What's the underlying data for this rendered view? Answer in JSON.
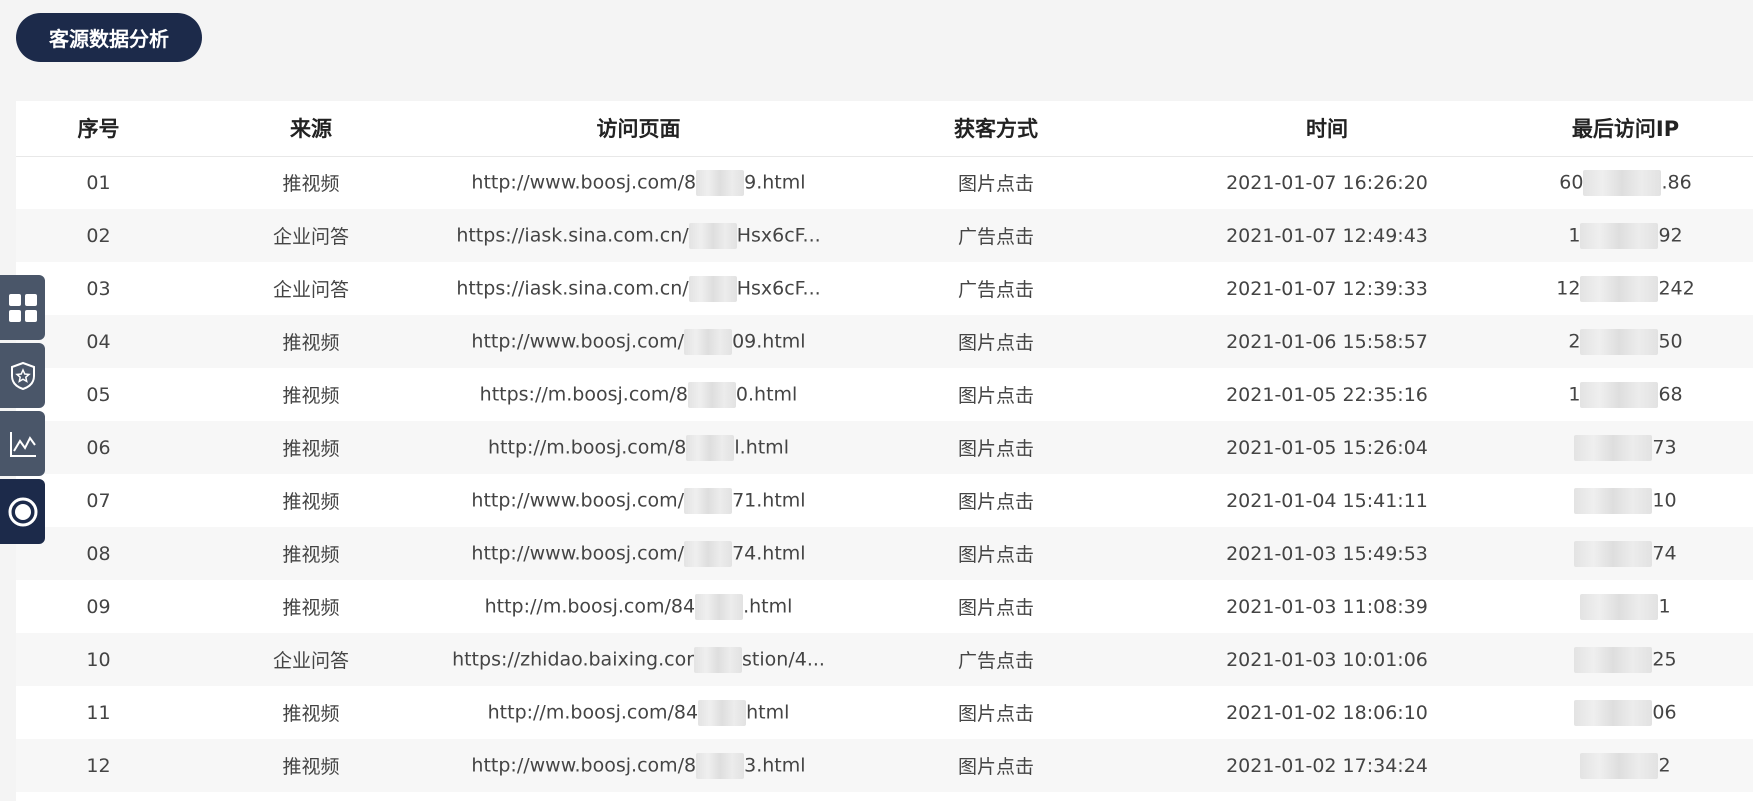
{
  "page": {
    "title": "客源数据分析"
  },
  "table": {
    "headers": [
      "序号",
      "来源",
      "访问页面",
      "获客方式",
      "时间",
      "最后访问IP"
    ],
    "rows": [
      {
        "no": "01",
        "source": "推视频",
        "url_prefix": "http://www.boosj.com/8",
        "url_suffix": "9.html",
        "method": "图片点击",
        "time": "2021-01-07 16:26:20",
        "ip_prefix": "60",
        "ip_suffix": ".86"
      },
      {
        "no": "02",
        "source": "企业问答",
        "url_prefix": "https://iask.sina.com.cn/",
        "url_suffix": "Hsx6cF...",
        "method": "广告点击",
        "time": "2021-01-07 12:49:43",
        "ip_prefix": "1",
        "ip_suffix": "92"
      },
      {
        "no": "03",
        "source": "企业问答",
        "url_prefix": "https://iask.sina.com.cn/",
        "url_suffix": "Hsx6cF...",
        "method": "广告点击",
        "time": "2021-01-07 12:39:33",
        "ip_prefix": "12",
        "ip_suffix": "242"
      },
      {
        "no": "04",
        "source": "推视频",
        "url_prefix": "http://www.boosj.com/",
        "url_suffix": "09.html",
        "method": "图片点击",
        "time": "2021-01-06 15:58:57",
        "ip_prefix": "2",
        "ip_suffix": "50"
      },
      {
        "no": "05",
        "source": "推视频",
        "url_prefix": "https://m.boosj.com/8",
        "url_suffix": "0.html",
        "method": "图片点击",
        "time": "2021-01-05 22:35:16",
        "ip_prefix": "1",
        "ip_suffix": "68"
      },
      {
        "no": "06",
        "source": "推视频",
        "url_prefix": "http://m.boosj.com/8",
        "url_suffix": "l.html",
        "method": "图片点击",
        "time": "2021-01-05 15:26:04",
        "ip_prefix": "",
        "ip_suffix": "73"
      },
      {
        "no": "07",
        "source": "推视频",
        "url_prefix": "http://www.boosj.com/",
        "url_suffix": "71.html",
        "method": "图片点击",
        "time": "2021-01-04 15:41:11",
        "ip_prefix": "",
        "ip_suffix": "10"
      },
      {
        "no": "08",
        "source": "推视频",
        "url_prefix": "http://www.boosj.com/",
        "url_suffix": "74.html",
        "method": "图片点击",
        "time": "2021-01-03 15:49:53",
        "ip_prefix": "",
        "ip_suffix": "74"
      },
      {
        "no": "09",
        "source": "推视频",
        "url_prefix": "http://m.boosj.com/84",
        "url_suffix": ".html",
        "method": "图片点击",
        "time": "2021-01-03 11:08:39",
        "ip_prefix": "",
        "ip_suffix": "1"
      },
      {
        "no": "10",
        "source": "企业问答",
        "url_prefix": "https://zhidao.baixing.cor",
        "url_suffix": "stion/4...",
        "method": "广告点击",
        "time": "2021-01-03 10:01:06",
        "ip_prefix": "",
        "ip_suffix": "25"
      },
      {
        "no": "11",
        "source": "推视频",
        "url_prefix": "http://m.boosj.com/84",
        "url_suffix": "html",
        "method": "图片点击",
        "time": "2021-01-02 18:06:10",
        "ip_prefix": "",
        "ip_suffix": "06"
      },
      {
        "no": "12",
        "source": "推视频",
        "url_prefix": "http://www.boosj.com/8",
        "url_suffix": "3.html",
        "method": "图片点击",
        "time": "2021-01-02 17:34:24",
        "ip_prefix": "",
        "ip_suffix": "2"
      }
    ]
  },
  "sidebar": {
    "items": [
      {
        "icon": "grid-icon"
      },
      {
        "icon": "shield-star-icon"
      },
      {
        "icon": "line-chart-icon"
      },
      {
        "icon": "target-circle-icon"
      }
    ]
  },
  "colors": {
    "title_bg": "#1c2a4a",
    "sidebar_bg": "#4a5669",
    "sidebar_active_bg": "#1c2a4a",
    "page_bg": "#f4f4f4",
    "row_alt_bg": "#f7f7f7"
  }
}
